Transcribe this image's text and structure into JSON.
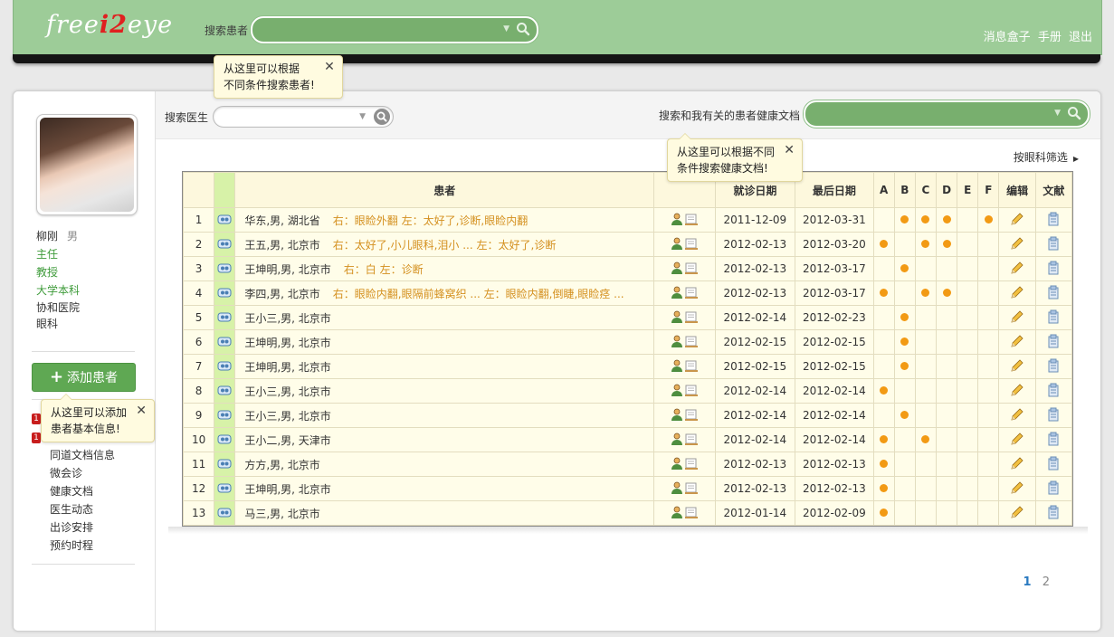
{
  "brand": {
    "logo_pre": "free",
    "logo_accent": "i2",
    "logo_post": "eye"
  },
  "top": {
    "search_label": "搜索患者",
    "search_value": "",
    "links": [
      "消息盒子",
      "手册",
      "退出"
    ]
  },
  "tips": {
    "patient_search": [
      "从这里可以根据",
      "不同条件搜索患者!"
    ],
    "doc_search": [
      "从这里可以根据不同",
      "条件搜索健康文档!"
    ],
    "add_patient": [
      "从这里可以添加",
      "患者基本信息!"
    ],
    "close": "✕"
  },
  "profile": {
    "name": "柳刚",
    "gender": "男",
    "title": "主任",
    "rank": "教授",
    "education": "大学本科",
    "hospital": "协和医院",
    "department": "眼科"
  },
  "add_button": {
    "plus": "+",
    "label": "添加患者"
  },
  "badges": [
    "1",
    "1"
  ],
  "side_menu": [
    "同道文档信息",
    "微会诊",
    "健康文档",
    "医生动态",
    "出诊安排",
    "预约时程"
  ],
  "search": {
    "doctor_label": "搜索医生",
    "doctor_value": "",
    "docs_label": "搜索和我有关的患者健康文档",
    "docs_value": ""
  },
  "filter_label": "按眼科筛选",
  "table": {
    "headers": {
      "patient": "患者",
      "visit_date": "就诊日期",
      "last_date": "最后日期",
      "edit": "编辑",
      "docs": "文献"
    },
    "flag_cols": [
      "A",
      "B",
      "C",
      "D",
      "E",
      "F"
    ],
    "rows": [
      {
        "n": "1",
        "patient": "华东,男, 湖北省",
        "diag": "右：眼睑外翻  左：太好了,诊断,眼睑内翻",
        "visit": "2011-12-09",
        "last": "2012-03-31",
        "flags": [
          0,
          1,
          1,
          1,
          0,
          1
        ]
      },
      {
        "n": "2",
        "patient": "王五,男, 北京市",
        "diag": "右：太好了,小儿眼科,泪小 ...  左：太好了,诊断",
        "visit": "2012-02-13",
        "last": "2012-03-20",
        "flags": [
          1,
          0,
          1,
          1,
          0,
          0
        ]
      },
      {
        "n": "3",
        "patient": "王坤明,男, 北京市",
        "diag": "右：白  左：诊断",
        "visit": "2012-02-13",
        "last": "2012-03-17",
        "flags": [
          0,
          1,
          0,
          0,
          0,
          0
        ]
      },
      {
        "n": "4",
        "patient": "李四,男, 北京市",
        "diag": "右：眼睑内翻,眼隔前蜂窝织 ...  左：眼睑内翻,倒睫,眼睑痉 ...",
        "visit": "2012-02-13",
        "last": "2012-03-17",
        "flags": [
          1,
          0,
          1,
          1,
          0,
          0
        ]
      },
      {
        "n": "5",
        "patient": "王小三,男, 北京市",
        "diag": "",
        "visit": "2012-02-14",
        "last": "2012-02-23",
        "flags": [
          0,
          1,
          0,
          0,
          0,
          0
        ]
      },
      {
        "n": "6",
        "patient": "王坤明,男, 北京市",
        "diag": "",
        "visit": "2012-02-15",
        "last": "2012-02-15",
        "flags": [
          0,
          1,
          0,
          0,
          0,
          0
        ]
      },
      {
        "n": "7",
        "patient": "王坤明,男, 北京市",
        "diag": "",
        "visit": "2012-02-15",
        "last": "2012-02-15",
        "flags": [
          0,
          1,
          0,
          0,
          0,
          0
        ]
      },
      {
        "n": "8",
        "patient": "王小三,男, 北京市",
        "diag": "",
        "visit": "2012-02-14",
        "last": "2012-02-14",
        "flags": [
          1,
          0,
          0,
          0,
          0,
          0
        ]
      },
      {
        "n": "9",
        "patient": "王小三,男, 北京市",
        "diag": "",
        "visit": "2012-02-14",
        "last": "2012-02-14",
        "flags": [
          0,
          1,
          0,
          0,
          0,
          0
        ]
      },
      {
        "n": "10",
        "patient": "王小二,男, 天津市",
        "diag": "",
        "visit": "2012-02-14",
        "last": "2012-02-14",
        "flags": [
          1,
          0,
          1,
          0,
          0,
          0
        ]
      },
      {
        "n": "11",
        "patient": "方方,男, 北京市",
        "diag": "",
        "visit": "2012-02-13",
        "last": "2012-02-13",
        "flags": [
          1,
          0,
          0,
          0,
          0,
          0
        ]
      },
      {
        "n": "12",
        "patient": "王坤明,男, 北京市",
        "diag": "",
        "visit": "2012-02-13",
        "last": "2012-02-13",
        "flags": [
          1,
          0,
          0,
          0,
          0,
          0
        ]
      },
      {
        "n": "13",
        "patient": "马三,男, 北京市",
        "diag": "",
        "visit": "2012-01-14",
        "last": "2012-02-09",
        "flags": [
          1,
          0,
          0,
          0,
          0,
          0
        ]
      }
    ]
  },
  "pager": {
    "current": "1",
    "next": "2"
  },
  "colors": {
    "green_bar": "#9dcc98",
    "accent_green": "#5fa853",
    "diag_orange": "#d4901f",
    "dot": "#f29a14",
    "pager_blue": "#2a7ac0"
  }
}
